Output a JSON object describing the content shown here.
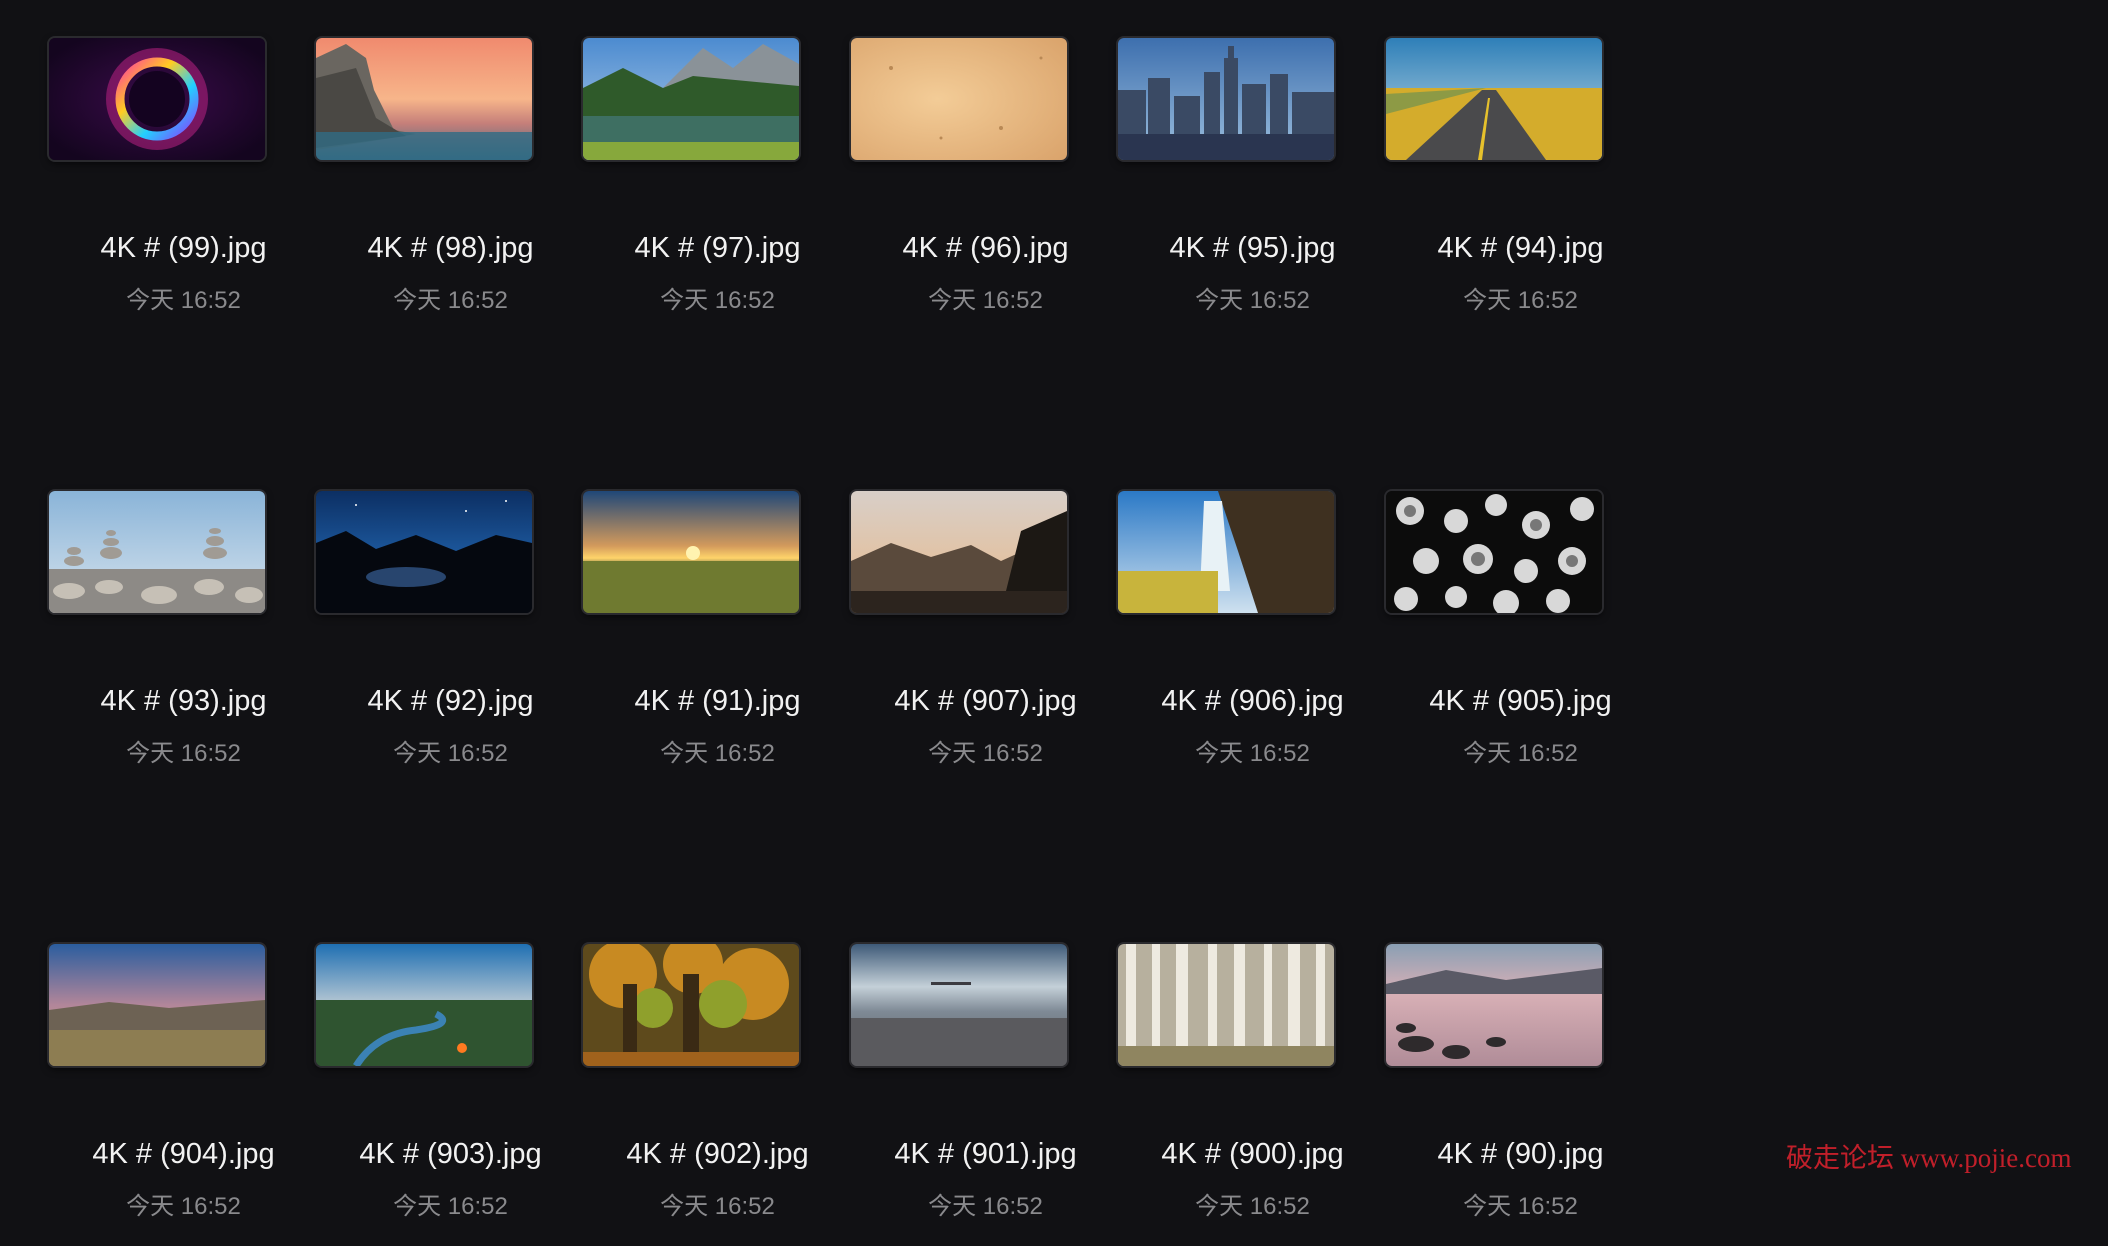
{
  "files": [
    {
      "name": "4K # (99).jpg",
      "date": "今天 16:52",
      "thumb": "abstract-ring-icon"
    },
    {
      "name": "4K # (98).jpg",
      "date": "今天 16:52",
      "thumb": "sea-cliff-sunset-icon"
    },
    {
      "name": "4K # (97).jpg",
      "date": "今天 16:52",
      "thumb": "mountain-lake-icon"
    },
    {
      "name": "4K # (96).jpg",
      "date": "今天 16:52",
      "thumb": "sand-texture-icon"
    },
    {
      "name": "4K # (95).jpg",
      "date": "今天 16:52",
      "thumb": "city-skyline-icon"
    },
    {
      "name": "4K # (94).jpg",
      "date": "今天 16:52",
      "thumb": "open-road-icon"
    },
    {
      "name": "4K # (93).jpg",
      "date": "今天 16:52",
      "thumb": "stacked-stones-icon"
    },
    {
      "name": "4K # (92).jpg",
      "date": "今天 16:52",
      "thumb": "night-lake-icon"
    },
    {
      "name": "4K # (91).jpg",
      "date": "今天 16:52",
      "thumb": "sunset-meadow-icon"
    },
    {
      "name": "4K # (907).jpg",
      "date": "今天 16:52",
      "thumb": "mountain-dusk-icon"
    },
    {
      "name": "4K # (906).jpg",
      "date": "今天 16:52",
      "thumb": "waterfall-icon"
    },
    {
      "name": "4K # (905).jpg",
      "date": "今天 16:52",
      "thumb": "jellyfish-icon"
    },
    {
      "name": "4K # (904).jpg",
      "date": "今天 16:52",
      "thumb": "desert-dusk-icon"
    },
    {
      "name": "4K # (903).jpg",
      "date": "今天 16:52",
      "thumb": "river-valley-icon"
    },
    {
      "name": "4K # (902).jpg",
      "date": "今天 16:52",
      "thumb": "autumn-tree-icon"
    },
    {
      "name": "4K # (901).jpg",
      "date": "今天 16:52",
      "thumb": "gray-beach-icon"
    },
    {
      "name": "4K # (900).jpg",
      "date": "今天 16:52",
      "thumb": "birch-forest-icon"
    },
    {
      "name": "4K # (90).jpg",
      "date": "今天 16:52",
      "thumb": "rocky-lake-icon"
    }
  ],
  "watermark": "破走论坛 www.pojie.com",
  "colors": {
    "background": "#111114",
    "filename": "#f2f2f2",
    "date": "#8a8a8d",
    "watermark": "#d0212c"
  }
}
